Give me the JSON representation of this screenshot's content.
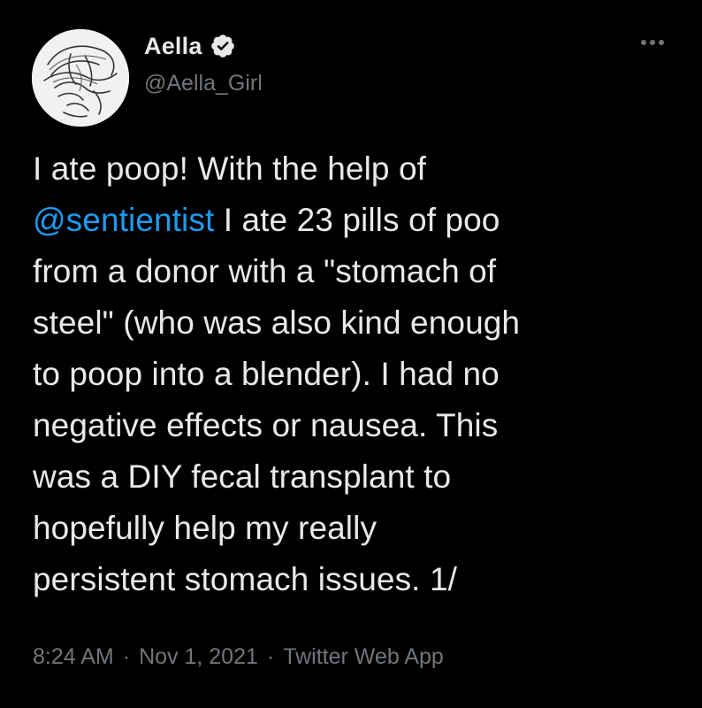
{
  "author": {
    "display_name": "Aella",
    "handle": "@Aella_Girl",
    "verified": true
  },
  "tweet": {
    "lines": [
      {
        "text": "I ate poop! With the help of"
      },
      {
        "mention": "@sentientist",
        "text": " I ate 23 pills of poo"
      },
      {
        "text": "from a donor with a \"stomach of"
      },
      {
        "text": "steel\" (who was also kind enough"
      },
      {
        "text": "to poop into a blender). I had no"
      },
      {
        "text": "negative effects or nausea. This"
      },
      {
        "text": "was a DIY fecal transplant to"
      },
      {
        "text": "hopefully help my really"
      },
      {
        "text": "persistent stomach issues. 1/"
      }
    ]
  },
  "meta": {
    "time": "8:24 AM",
    "separator": "·",
    "date": "Nov 1, 2021",
    "source": "Twitter Web App"
  },
  "icons": {
    "verified": "verified-badge-icon",
    "more": "more-options-icon"
  },
  "colors": {
    "background": "#000000",
    "text": "#e7e9ea",
    "secondary": "#71767b",
    "accent": "#1d9bf0"
  }
}
